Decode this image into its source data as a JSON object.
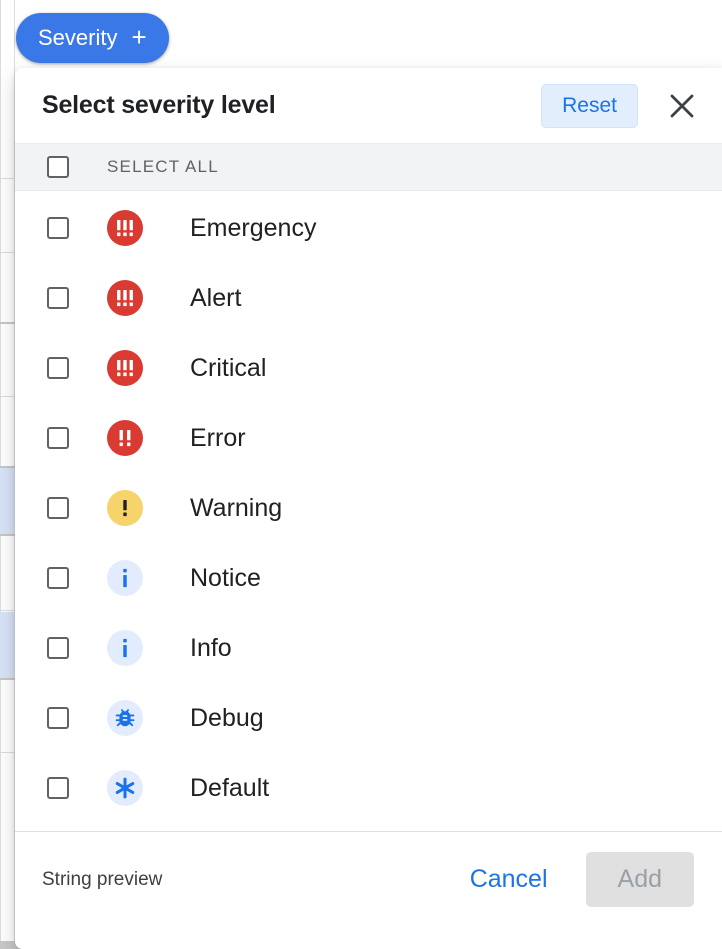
{
  "chip": {
    "label": "Severity",
    "add_icon": "plus-icon",
    "color": "#3b78e7"
  },
  "dialog": {
    "title": "Select severity level",
    "reset_label": "Reset",
    "close_icon": "close-icon",
    "select_all_label": "SELECT ALL",
    "items": [
      {
        "label": "Emergency",
        "icon": "severity-emergency-icon",
        "icon_glyph": "!!!",
        "icon_bg": "#d93a31",
        "icon_fg": "#ffffff",
        "shape": "filled"
      },
      {
        "label": "Alert",
        "icon": "severity-alert-icon",
        "icon_glyph": "!!!",
        "icon_bg": "#d93a31",
        "icon_fg": "#ffffff",
        "shape": "filled"
      },
      {
        "label": "Critical",
        "icon": "severity-critical-icon",
        "icon_glyph": "!!!",
        "icon_bg": "#d93a31",
        "icon_fg": "#ffffff",
        "shape": "filled"
      },
      {
        "label": "Error",
        "icon": "severity-error-icon",
        "icon_glyph": "!!",
        "icon_bg": "#d93a31",
        "icon_fg": "#ffffff",
        "shape": "filled"
      },
      {
        "label": "Warning",
        "icon": "severity-warning-icon",
        "icon_glyph": "!",
        "icon_bg": "#f6d36b",
        "icon_fg": "#202124",
        "shape": "filled"
      },
      {
        "label": "Notice",
        "icon": "severity-notice-icon",
        "icon_glyph": "i",
        "icon_bg": "#e3ecfc",
        "icon_fg": "#1a73e8",
        "shape": "info"
      },
      {
        "label": "Info",
        "icon": "severity-info-icon",
        "icon_glyph": "i",
        "icon_bg": "#e3ecfc",
        "icon_fg": "#1a73e8",
        "shape": "info"
      },
      {
        "label": "Debug",
        "icon": "severity-debug-icon",
        "icon_glyph": "bug",
        "icon_bg": "#e3ecfc",
        "icon_fg": "#1a73e8",
        "shape": "bug"
      },
      {
        "label": "Default",
        "icon": "severity-default-icon",
        "icon_glyph": "*",
        "icon_bg": "#e3ecfc",
        "icon_fg": "#1a73e8",
        "shape": "asterisk"
      }
    ],
    "footer": {
      "string_preview_label": "String preview",
      "cancel_label": "Cancel",
      "add_label": "Add",
      "add_enabled": false
    }
  },
  "colors": {
    "accent_blue": "#1a73e8",
    "chip_blue": "#3b78e7",
    "severity_red": "#d93a31",
    "severity_yellow": "#f6d36b",
    "icon_blue_bg": "#e3ecfc"
  }
}
